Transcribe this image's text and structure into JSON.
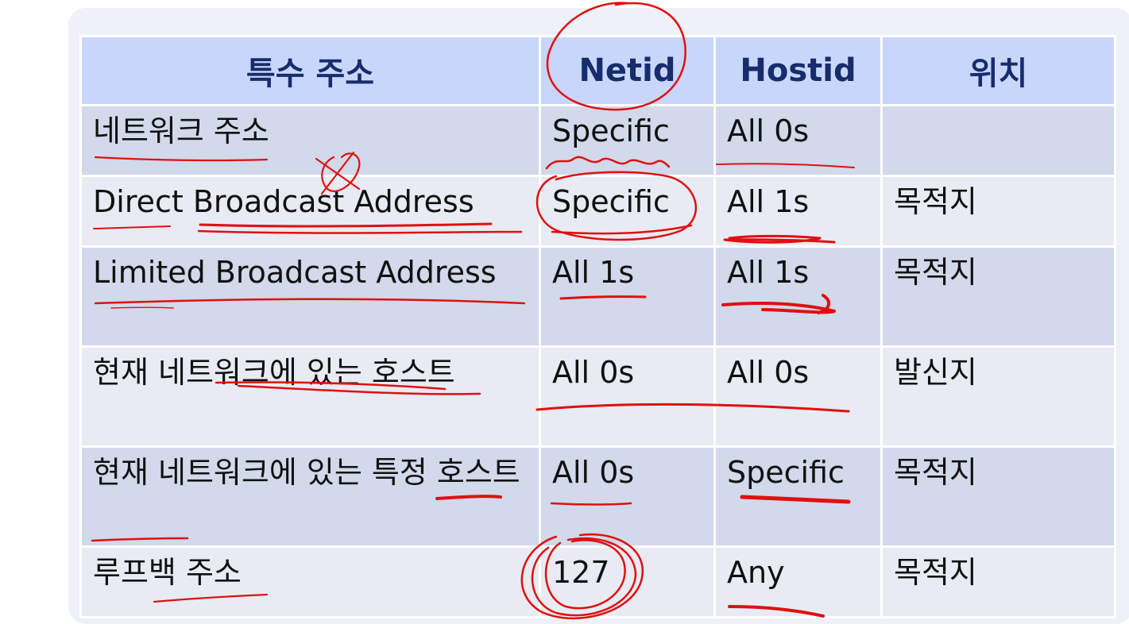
{
  "table": {
    "headers": [
      "특수 주소",
      "Netid",
      "Hostid",
      "위치"
    ],
    "rows": [
      {
        "name": "네트워크 주소",
        "netid": "Specific",
        "hostid": "All 0s",
        "location": ""
      },
      {
        "name": "Direct Broadcast Address",
        "netid": "Specific",
        "hostid": "All 1s",
        "location": "목적지"
      },
      {
        "name": "Limited Broadcast Address",
        "netid": "All 1s",
        "hostid": "All 1s",
        "location": "목적지"
      },
      {
        "name": "현재 네트워크에 있는 호스트",
        "netid": "All 0s",
        "hostid": "All 0s",
        "location": "발신지"
      },
      {
        "name": "현재 네트워크에 있는 특정 호스트",
        "netid": "All 0s",
        "hostid": "Specific",
        "location": "목적지"
      },
      {
        "name": "루프백 주소",
        "netid": "127",
        "hostid": "Any",
        "location": "목적지"
      }
    ]
  },
  "colors": {
    "header_bg": "#c8d6fb",
    "header_text": "#172c6b",
    "row_odd_bg": "#d1d9ea",
    "row_even_bg": "#e8ebf3",
    "annotation_ink": "#e01010"
  }
}
